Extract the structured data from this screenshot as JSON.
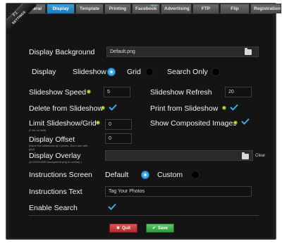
{
  "tabs": [
    {
      "label": "General"
    },
    {
      "label": "Display",
      "active": true
    },
    {
      "label": "Template"
    },
    {
      "label": "Printing"
    },
    {
      "label": "Facebook",
      "badge": "NEW"
    },
    {
      "label": "Advertising"
    },
    {
      "label": "FTP"
    },
    {
      "label": "Flip Books"
    },
    {
      "label": "Registration"
    }
  ],
  "corner": {
    "top": "F1",
    "bottom": "SETTINGS"
  },
  "form": {
    "display_background": {
      "label": "Display Background",
      "value": "Default.png"
    },
    "display_mode": {
      "label": "Display",
      "options": [
        "Slideshow",
        "Grid",
        "Search Only"
      ],
      "selected": "Slideshow"
    },
    "slideshow_speed": {
      "label": "Slideshow Speed",
      "value": "5"
    },
    "slideshow_refresh": {
      "label": "Slideshow Refresh",
      "value": "20"
    },
    "delete_from_slideshow": {
      "label": "Delete from Slideshow",
      "checked": true
    },
    "print_from_slideshow": {
      "label": "Print from Slideshow",
      "checked": true
    },
    "limit_slideshow_grid": {
      "label": "Limit Slideshow/Grid",
      "note": "(0 for no limit)",
      "value": "0"
    },
    "show_composited_images": {
      "label": "Show Composited Images",
      "checked": true
    },
    "display_offset": {
      "label": "Display Offset",
      "note": "(Move the slideshow by x pixels. Don't use with grid)",
      "value": "0"
    },
    "display_overlay": {
      "label": "Display Overlay",
      "note": "(A 1920x1080 transparent png to overlay )",
      "value": "",
      "clear_label": "Clear"
    },
    "instructions_screen": {
      "label": "Instructions Screen",
      "options": [
        "Default",
        "Custom"
      ],
      "selected": "Default"
    },
    "instructions_text": {
      "label": "Instructions Text",
      "value": "Tag Your Photos"
    },
    "enable_search": {
      "label": "Enable Search",
      "checked": true
    }
  },
  "buttons": {
    "quit": "Quit",
    "save": "Save"
  },
  "colors": {
    "accent": "#39a9ea",
    "tab_active": "#2a8ccc",
    "quit": "#c93a3a",
    "save": "#3fae4c",
    "info": "#9ccc2a"
  }
}
